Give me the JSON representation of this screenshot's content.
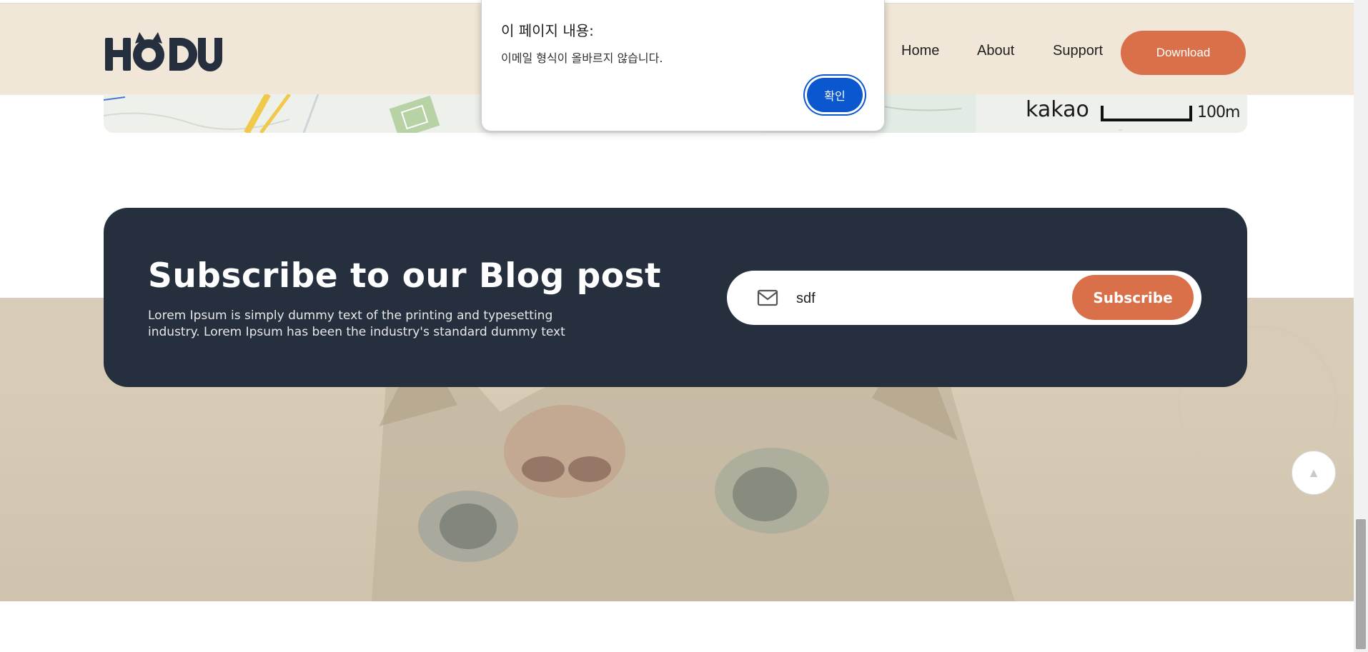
{
  "header": {
    "logo_text": "HODU",
    "nav": {
      "home": "Home",
      "about": "About",
      "support": "Support"
    },
    "download_label": "Download"
  },
  "map": {
    "brand": "kakao",
    "scale_label": "100m"
  },
  "subscribe": {
    "title": "Subscribe to our Blog post",
    "description": "Lorem Ipsum is simply dummy text of the printing and typesetting industry. Lorem Ipsum has been the industry's standard dummy text",
    "email_value": "sdf",
    "button_label": "Subscribe"
  },
  "scroll_top": {
    "glyph": "▲"
  },
  "alert": {
    "title": "이 페이지 내용:",
    "message": "이메일 형식이 올바르지 않습니다.",
    "ok_label": "확인"
  },
  "colors": {
    "header_bg": "#f1e7d8",
    "brand_orange": "#d9704a",
    "dark_navy": "#252f3e",
    "alert_button": "#0b57d0"
  },
  "icons": {
    "logo": "hodu-cat-logo",
    "mail": "mail-icon",
    "scroll_top": "arrow-up-icon"
  }
}
